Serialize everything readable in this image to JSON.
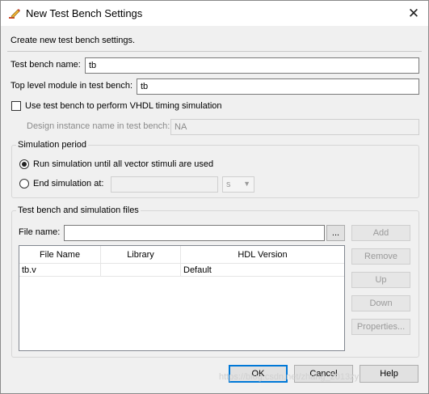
{
  "window": {
    "title": "New Test Bench Settings",
    "close_glyph": "✕"
  },
  "header": {
    "description": "Create new test bench settings."
  },
  "fields": {
    "tb_name_label": "Test bench name:",
    "tb_name_value": "tb",
    "top_module_label": "Top level module in test bench:",
    "top_module_value": "tb",
    "vhdl_timing_label": "Use test bench to perform VHDL timing simulation",
    "vhdl_timing_checked": false,
    "design_instance_label": "Design instance name in test bench:",
    "design_instance_value": "NA"
  },
  "simulation_period": {
    "title": "Simulation period",
    "option_run_all": "Run simulation until all vector stimuli are used",
    "option_end_at": "End simulation at:",
    "selected": "run_all",
    "end_value": "",
    "unit": "s"
  },
  "files": {
    "title": "Test bench and simulation files",
    "file_name_label": "File name:",
    "file_name_value": "",
    "browse_label": "...",
    "columns": [
      "File Name",
      "Library",
      "HDL Version"
    ],
    "rows": [
      {
        "file": "tb.v",
        "library": "",
        "hdl": "Default"
      }
    ],
    "buttons": {
      "add": "Add",
      "remove": "Remove",
      "up": "Up",
      "down": "Down",
      "properties": "Properties..."
    }
  },
  "footer": {
    "ok": "OK",
    "cancel": "Cancel",
    "help": "Help"
  },
  "watermark": "https://blog.csdn.net/zhang_2013zy",
  "colors": {
    "accent": "#0078d7",
    "dialog_bg": "#f0f0f0"
  },
  "icons": {
    "title_icon": "pencil-settings-icon",
    "close": "close-icon"
  }
}
